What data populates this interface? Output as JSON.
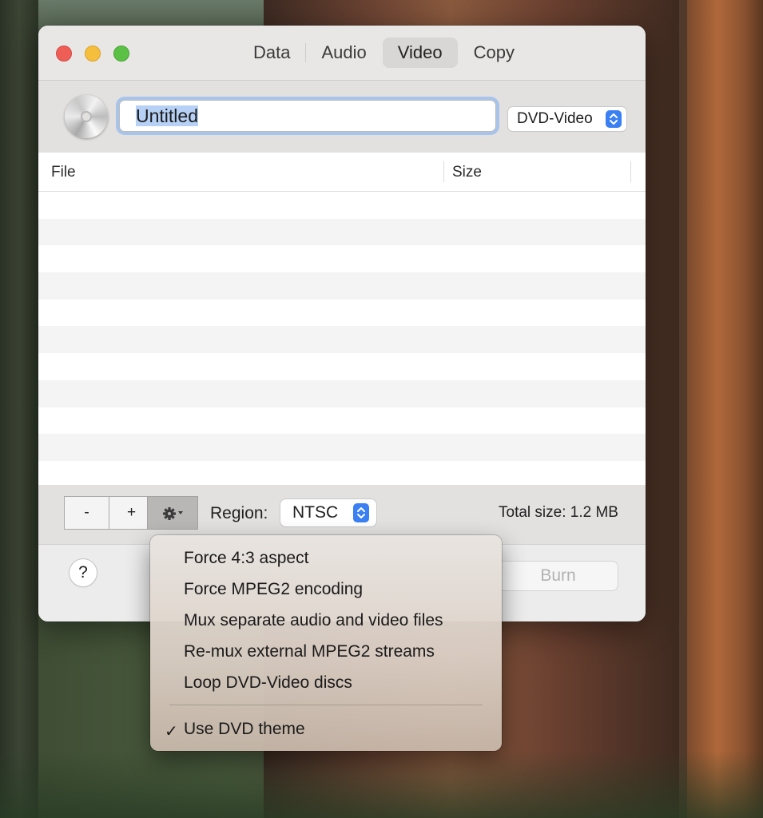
{
  "tabs": [
    {
      "label": "Data",
      "active": false
    },
    {
      "label": "Audio",
      "active": false
    },
    {
      "label": "Video",
      "active": true
    },
    {
      "label": "Copy",
      "active": false
    }
  ],
  "disc": {
    "title": "Untitled",
    "format": "DVD-Video",
    "icon": "cd-disc-icon"
  },
  "table": {
    "columns": [
      "File",
      "Size"
    ],
    "rows": []
  },
  "toolbar": {
    "minus_label": "-",
    "plus_label": "+",
    "gear_icon": "gear-icon",
    "region_label": "Region:",
    "region_value": "NTSC",
    "total_size": "Total size: 1.2 MB"
  },
  "footer": {
    "help_label": "?",
    "burn_label": "Burn"
  },
  "menu": {
    "items": [
      {
        "label": "Force 4:3 aspect",
        "checked": false
      },
      {
        "label": "Force MPEG2 encoding",
        "checked": false
      },
      {
        "label": "Mux separate audio and video files",
        "checked": false
      },
      {
        "label": "Re-mux external MPEG2 streams",
        "checked": false
      },
      {
        "label": "Loop DVD-Video discs",
        "checked": false
      }
    ],
    "theme_item": {
      "label": "Use DVD theme",
      "checked": true,
      "check_mark": "✓"
    }
  },
  "colors": {
    "accent": "#3a80f2",
    "focus_ring": "#a9c4ea",
    "close": "#ee5e56",
    "minimize": "#f5be3c",
    "maximize": "#5ac144"
  }
}
